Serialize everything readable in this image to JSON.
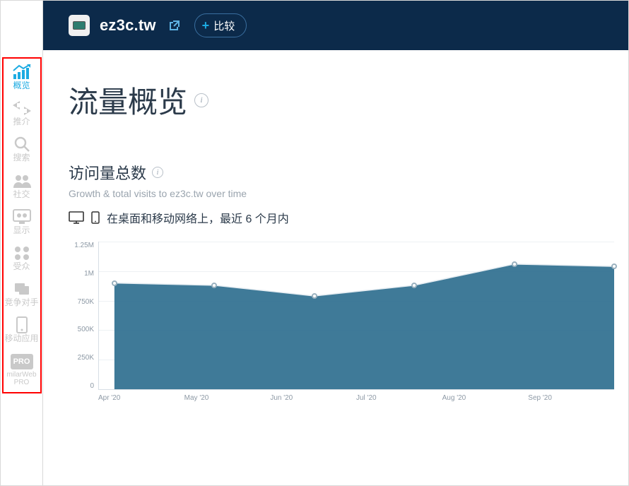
{
  "header": {
    "site_name": "ez3c.tw",
    "compare_label": "比较"
  },
  "sidebar": {
    "items": [
      {
        "label": "概览",
        "icon": "overview"
      },
      {
        "label": "推介",
        "icon": "referral"
      },
      {
        "label": "搜索",
        "icon": "search"
      },
      {
        "label": "社交",
        "icon": "social"
      },
      {
        "label": "显示",
        "icon": "display"
      },
      {
        "label": "受众",
        "icon": "audience"
      },
      {
        "label": "竞争对手",
        "icon": "competitor"
      },
      {
        "label": "移动应用",
        "icon": "mobile"
      }
    ],
    "pro_label_1": "PRO",
    "pro_label_2": "milarWeb",
    "pro_label_3": "PRO"
  },
  "page": {
    "title": "流量概览"
  },
  "section_visits": {
    "title": "访问量总数",
    "subtitle": "Growth & total visits to ez3c.tw over time",
    "device_text": "在桌面和移动网络上，最近 6 个月内"
  },
  "chart_data": {
    "type": "area",
    "title": "访问量总数",
    "xlabel": "",
    "ylabel": "",
    "ylim": [
      0,
      1250000
    ],
    "y_ticks": [
      "1.25M",
      "1M",
      "750K",
      "500K",
      "250K",
      "0"
    ],
    "categories": [
      "Apr '20",
      "May '20",
      "Jun '20",
      "Jul '20",
      "Aug '20",
      "Sep '20"
    ],
    "values": [
      900000,
      880000,
      790000,
      880000,
      1060000,
      1040000
    ],
    "area_color": "#2f6f8f",
    "line_color": "#9ab1bf",
    "point_color": "#ffffff"
  }
}
